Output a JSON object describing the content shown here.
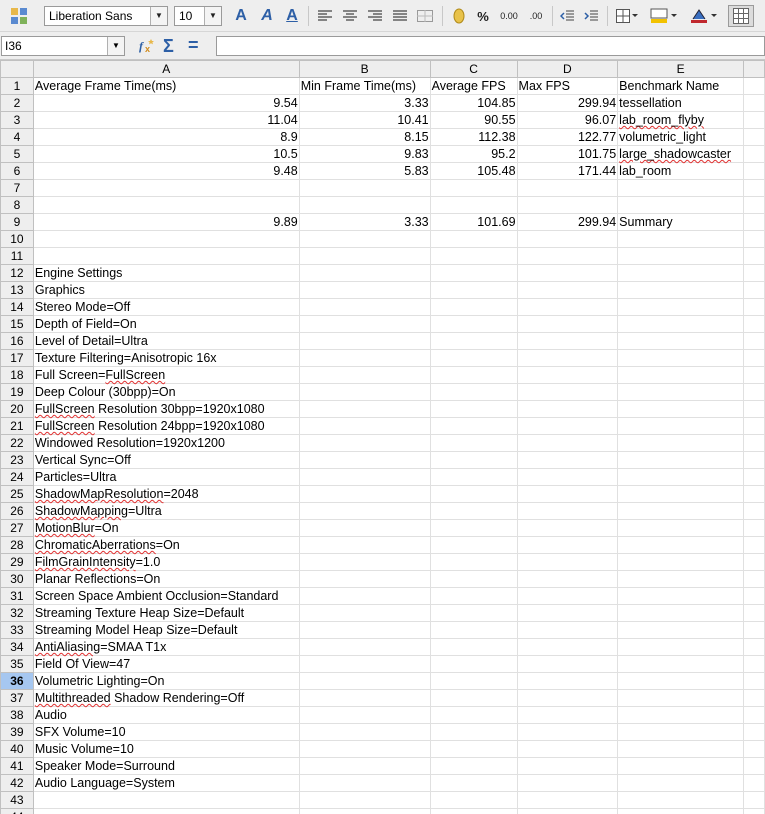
{
  "toolbar": {
    "font_name": "Liberation Sans",
    "font_size": "10",
    "icons": [
      "styles-icon",
      "bold-icon",
      "italic-icon",
      "underline-icon",
      "align-left-icon",
      "align-center-icon",
      "align-right-icon",
      "justify-icon",
      "merge-cells-icon",
      "currency-icon",
      "percent-icon",
      "number-format-icon",
      "decimal-icon",
      "decrease-indent-icon",
      "increase-indent-icon",
      "borders-icon",
      "background-color-icon",
      "font-color-icon",
      "grid-lines-icon"
    ]
  },
  "formula_bar": {
    "cell_reference": "I36",
    "formula": ""
  },
  "columns": [
    "A",
    "B",
    "C",
    "D",
    "E"
  ],
  "active_row": "36",
  "rows": [
    {
      "n": "1",
      "a": "Average Frame Time(ms)",
      "b": "Min Frame Time(ms)",
      "c": "Average FPS",
      "d": "Max FPS",
      "e": "Benchmark Name"
    },
    {
      "n": "2",
      "a": "9.54",
      "b": "3.33",
      "c": "104.85",
      "d": "299.94",
      "e": "tessellation"
    },
    {
      "n": "3",
      "a": "11.04",
      "b": "10.41",
      "c": "90.55",
      "d": "96.07",
      "e": "lab_room_flyby"
    },
    {
      "n": "4",
      "a": "8.9",
      "b": "8.15",
      "c": "112.38",
      "d": "122.77",
      "e": "volumetric_light"
    },
    {
      "n": "5",
      "a": "10.5",
      "b": "9.83",
      "c": "95.2",
      "d": "101.75",
      "e": "large_shadowcaster"
    },
    {
      "n": "6",
      "a": "9.48",
      "b": "5.83",
      "c": "105.48",
      "d": "171.44",
      "e": "lab_room"
    },
    {
      "n": "7",
      "a": "",
      "b": "",
      "c": "",
      "d": "",
      "e": ""
    },
    {
      "n": "8",
      "a": "",
      "b": "",
      "c": "",
      "d": "",
      "e": ""
    },
    {
      "n": "9",
      "a": "9.89",
      "b": "3.33",
      "c": "101.69",
      "d": "299.94",
      "e": "Summary"
    },
    {
      "n": "10",
      "a": "",
      "b": "",
      "c": "",
      "d": "",
      "e": ""
    },
    {
      "n": "11",
      "a": "",
      "b": "",
      "c": "",
      "d": "",
      "e": ""
    },
    {
      "n": "12",
      "a": "Engine Settings",
      "b": "",
      "c": "",
      "d": "",
      "e": ""
    },
    {
      "n": "13",
      "a": "Graphics",
      "b": "",
      "c": "",
      "d": "",
      "e": ""
    },
    {
      "n": "14",
      "a": "Stereo Mode=Off",
      "b": "",
      "c": "",
      "d": "",
      "e": ""
    },
    {
      "n": "15",
      "a": "Depth of Field=On",
      "b": "",
      "c": "",
      "d": "",
      "e": ""
    },
    {
      "n": "16",
      "a": "Level of Detail=Ultra",
      "b": "",
      "c": "",
      "d": "",
      "e": ""
    },
    {
      "n": "17",
      "a": "Texture Filtering=Anisotropic 16x",
      "b": "",
      "c": "",
      "d": "",
      "e": ""
    },
    {
      "n": "18",
      "a": "Full Screen=FullScreen",
      "b": "",
      "c": "",
      "d": "",
      "e": ""
    },
    {
      "n": "19",
      "a": "Deep Colour (30bpp)=On",
      "b": "",
      "c": "",
      "d": "",
      "e": ""
    },
    {
      "n": "20",
      "a": "FullScreen Resolution 30bpp=1920x1080",
      "b": "",
      "c": "",
      "d": "",
      "e": ""
    },
    {
      "n": "21",
      "a": "FullScreen Resolution 24bpp=1920x1080",
      "b": "",
      "c": "",
      "d": "",
      "e": ""
    },
    {
      "n": "22",
      "a": "Windowed Resolution=1920x1200",
      "b": "",
      "c": "",
      "d": "",
      "e": ""
    },
    {
      "n": "23",
      "a": "Vertical Sync=Off",
      "b": "",
      "c": "",
      "d": "",
      "e": ""
    },
    {
      "n": "24",
      "a": "Particles=Ultra",
      "b": "",
      "c": "",
      "d": "",
      "e": ""
    },
    {
      "n": "25",
      "a": "ShadowMapResolution=2048",
      "b": "",
      "c": "",
      "d": "",
      "e": ""
    },
    {
      "n": "26",
      "a": "ShadowMapping=Ultra",
      "b": "",
      "c": "",
      "d": "",
      "e": ""
    },
    {
      "n": "27",
      "a": "MotionBlur=On",
      "b": "",
      "c": "",
      "d": "",
      "e": ""
    },
    {
      "n": "28",
      "a": "ChromaticAberrations=On",
      "b": "",
      "c": "",
      "d": "",
      "e": ""
    },
    {
      "n": "29",
      "a": "FilmGrainIntensity=1.0",
      "b": "",
      "c": "",
      "d": "",
      "e": ""
    },
    {
      "n": "30",
      "a": "Planar Reflections=On",
      "b": "",
      "c": "",
      "d": "",
      "e": ""
    },
    {
      "n": "31",
      "a": "Screen Space Ambient Occlusion=Standard",
      "b": "",
      "c": "",
      "d": "",
      "e": ""
    },
    {
      "n": "32",
      "a": "Streaming Texture Heap Size=Default",
      "b": "",
      "c": "",
      "d": "",
      "e": ""
    },
    {
      "n": "33",
      "a": "Streaming Model Heap Size=Default",
      "b": "",
      "c": "",
      "d": "",
      "e": ""
    },
    {
      "n": "34",
      "a": "AntiAliasing=SMAA T1x",
      "b": "",
      "c": "",
      "d": "",
      "e": ""
    },
    {
      "n": "35",
      "a": "Field Of View=47",
      "b": "",
      "c": "",
      "d": "",
      "e": ""
    },
    {
      "n": "36",
      "a": "Volumetric Lighting=On",
      "b": "",
      "c": "",
      "d": "",
      "e": ""
    },
    {
      "n": "37",
      "a": "Multithreaded Shadow Rendering=Off",
      "b": "",
      "c": "",
      "d": "",
      "e": ""
    },
    {
      "n": "38",
      "a": "Audio",
      "b": "",
      "c": "",
      "d": "",
      "e": ""
    },
    {
      "n": "39",
      "a": "SFX Volume=10",
      "b": "",
      "c": "",
      "d": "",
      "e": ""
    },
    {
      "n": "40",
      "a": "Music Volume=10",
      "b": "",
      "c": "",
      "d": "",
      "e": ""
    },
    {
      "n": "41",
      "a": "Speaker Mode=Surround",
      "b": "",
      "c": "",
      "d": "",
      "e": ""
    },
    {
      "n": "42",
      "a": "Audio Language=System",
      "b": "",
      "c": "",
      "d": "",
      "e": ""
    },
    {
      "n": "43",
      "a": "",
      "b": "",
      "c": "",
      "d": "",
      "e": ""
    },
    {
      "n": "44",
      "a": "",
      "b": "",
      "c": "",
      "d": "",
      "e": ""
    }
  ]
}
